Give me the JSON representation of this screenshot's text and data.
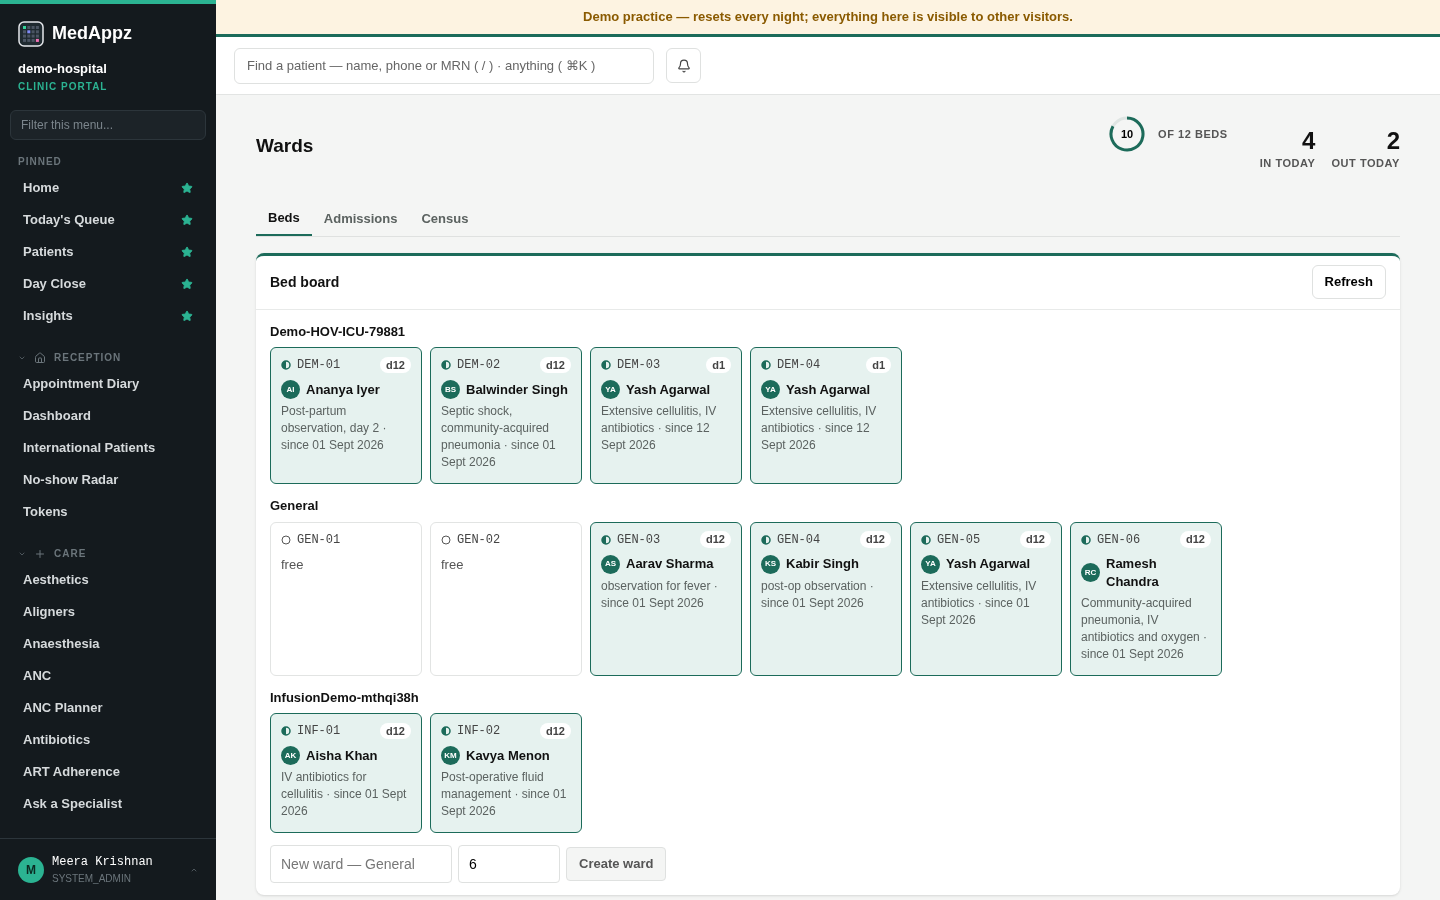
{
  "banner": "Demo practice — resets every night; everything here is visible to other visitors.",
  "sidebar": {
    "brand": "MedAppz",
    "org": "demo-hospital",
    "portal": "CLINIC PORTAL",
    "filter_placeholder": "Filter this menu...",
    "sections": [
      {
        "kind": "pinned",
        "title": "PINNED",
        "items": [
          {
            "label": "Home",
            "starred": true
          },
          {
            "label": "Today's Queue",
            "starred": true
          },
          {
            "label": "Patients",
            "starred": true
          },
          {
            "label": "Day Close",
            "starred": true
          },
          {
            "label": "Insights",
            "starred": true
          }
        ]
      },
      {
        "kind": "reception",
        "title": "RECEPTION",
        "expanded": true,
        "items": [
          {
            "label": "Appointment Diary",
            "starred": false
          },
          {
            "label": "Dashboard",
            "starred": false
          },
          {
            "label": "International Patients",
            "starred": false
          },
          {
            "label": "No-show Radar",
            "starred": false
          },
          {
            "label": "Tokens",
            "starred": false
          }
        ]
      },
      {
        "kind": "care",
        "title": "CARE",
        "expanded": true,
        "items": [
          {
            "label": "Aesthetics",
            "starred": false
          },
          {
            "label": "Aligners",
            "starred": false
          },
          {
            "label": "Anaesthesia",
            "starred": false
          },
          {
            "label": "ANC",
            "starred": false
          },
          {
            "label": "ANC Planner",
            "starred": false
          },
          {
            "label": "Antibiotics",
            "starred": false
          },
          {
            "label": "ART Adherence",
            "starred": false
          },
          {
            "label": "Ask a Specialist",
            "starred": false
          }
        ]
      }
    ],
    "user": {
      "initial": "M",
      "name": "Meera Krishnan",
      "role": "SYSTEM_ADMIN"
    }
  },
  "search": {
    "placeholder": "Find a patient — name, phone or MRN ( / ) · anything ( ⌘K )"
  },
  "page": {
    "title": "Wards",
    "occupancy": {
      "count": "10",
      "level": 0.83,
      "label": "OF 12 BEDS"
    },
    "stats": [
      {
        "value": "4",
        "label": "IN TODAY"
      },
      {
        "value": "2",
        "label": "OUT TODAY"
      }
    ]
  },
  "tabs": [
    {
      "label": "Beds",
      "selected": true
    },
    {
      "label": "Admissions",
      "selected": false
    },
    {
      "label": "Census",
      "selected": false
    }
  ],
  "board": {
    "title": "Bed board",
    "refresh": "Refresh",
    "wards": [
      {
        "name": "Demo-HOV-ICU-79881",
        "beds": [
          {
            "code": "DEM-01",
            "occupied": true,
            "days": "d12",
            "initials": "AI",
            "patient": "Ananya Iyer",
            "note": "Post-partum observation, day 2 · since 01 Sept 2026"
          },
          {
            "code": "DEM-02",
            "occupied": true,
            "days": "d12",
            "initials": "BS",
            "patient": "Balwinder Singh",
            "note": "Septic shock, community-acquired pneumonia · since 01 Sept 2026"
          },
          {
            "code": "DEM-03",
            "occupied": true,
            "days": "d1",
            "initials": "YA",
            "patient": "Yash Agarwal",
            "note": "Extensive cellulitis, IV antibiotics · since 12 Sept 2026"
          },
          {
            "code": "DEM-04",
            "occupied": true,
            "days": "d1",
            "initials": "YA",
            "patient": "Yash Agarwal",
            "note": "Extensive cellulitis, IV antibiotics · since 12 Sept 2026"
          }
        ]
      },
      {
        "name": "General",
        "beds": [
          {
            "code": "GEN-01",
            "occupied": false,
            "status": "free"
          },
          {
            "code": "GEN-02",
            "occupied": false,
            "status": "free"
          },
          {
            "code": "GEN-03",
            "occupied": true,
            "days": "d12",
            "initials": "AS",
            "patient": "Aarav Sharma",
            "note": "observation for fever · since 01 Sept 2026"
          },
          {
            "code": "GEN-04",
            "occupied": true,
            "days": "d12",
            "initials": "KS",
            "patient": "Kabir Singh",
            "note": "post-op observation · since 01 Sept 2026"
          },
          {
            "code": "GEN-05",
            "occupied": true,
            "days": "d12",
            "initials": "YA",
            "patient": "Yash Agarwal",
            "note": "Extensive cellulitis, IV antibiotics · since 01 Sept 2026"
          },
          {
            "code": "GEN-06",
            "occupied": true,
            "days": "d12",
            "initials": "RC",
            "patient": "Ramesh Chandra",
            "note": "Community-acquired pneumonia, IV antibiotics and oxygen · since 01 Sept 2026"
          }
        ]
      },
      {
        "name": "InfusionDemo-mthqi38h",
        "beds": [
          {
            "code": "INF-01",
            "occupied": true,
            "days": "d12",
            "initials": "AK",
            "patient": "Aisha Khan",
            "note": "IV antibiotics for cellulitis · since 01 Sept 2026"
          },
          {
            "code": "INF-02",
            "occupied": true,
            "days": "d12",
            "initials": "KM",
            "patient": "Kavya Menon",
            "note": "Post-operative fluid management · since 01 Sept 2026"
          }
        ]
      }
    ],
    "new_ward": {
      "name_placeholder": "New ward — General",
      "beds_value": "6",
      "create": "Create ward"
    }
  }
}
